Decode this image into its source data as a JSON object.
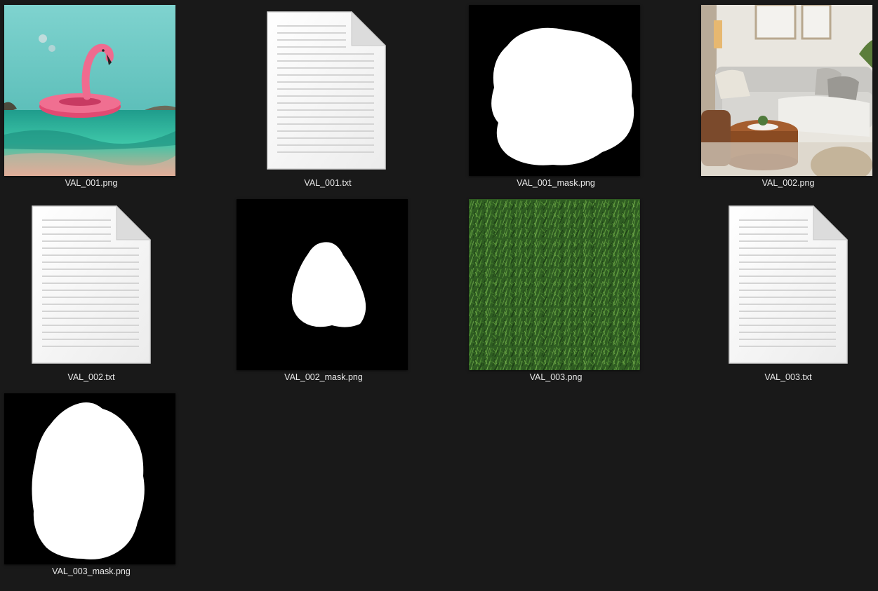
{
  "files": [
    {
      "name": "VAL_001.png",
      "kind": "image",
      "preview": "flamingo-float-in-sea"
    },
    {
      "name": "VAL_001.txt",
      "kind": "text-document"
    },
    {
      "name": "VAL_001_mask.png",
      "kind": "mask"
    },
    {
      "name": "VAL_002.png",
      "kind": "image",
      "preview": "living-room-sofa"
    },
    {
      "name": "VAL_002.txt",
      "kind": "text-document"
    },
    {
      "name": "VAL_002_mask.png",
      "kind": "mask"
    },
    {
      "name": "VAL_003.png",
      "kind": "image",
      "preview": "grass-texture"
    },
    {
      "name": "VAL_003.txt",
      "kind": "text-document"
    },
    {
      "name": "VAL_003_mask.png",
      "kind": "mask"
    }
  ],
  "colors": {
    "background": "#191919",
    "caption": "#e8e8e8",
    "mask_black": "#000000",
    "mask_white": "#ffffff"
  }
}
